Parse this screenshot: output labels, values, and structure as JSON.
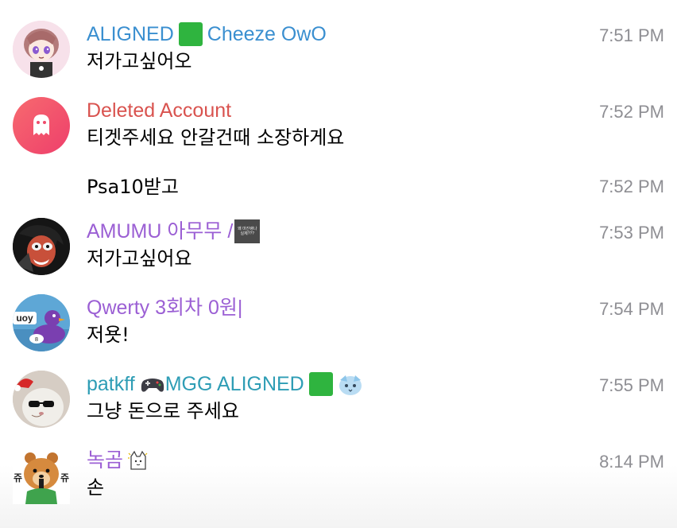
{
  "colors": {
    "name_blue": "#3a8fd0",
    "name_red": "#d9534f",
    "name_purple": "#9b5fd4",
    "name_teal": "#2e9db5",
    "timestamp": "#8e8e93",
    "ghost_avatar_bg": "#f0506a"
  },
  "messages": [
    {
      "sender": "ALIGNED",
      "sender_emoji": "green-square",
      "sender_suffix": "Cheeze OwO",
      "text": "저가고싶어오",
      "time": "7:51 PM",
      "avatar": "anime-character-avatar"
    },
    {
      "sender": "Deleted Account",
      "text": "티겟주세요 안갈건때 소장하게요",
      "time": "7:52 PM",
      "avatar": "ghost-icon"
    },
    {
      "text": "Psa10받고",
      "time": "7:52 PM"
    },
    {
      "sender": "AMUMU 아무무 /",
      "sender_badge_text": "왜 마진랭나 실제???",
      "text": "저가고싶어요",
      "time": "7:53 PM",
      "avatar": "manga-face-avatar"
    },
    {
      "sender": "Qwerty 3회차 0원|",
      "text": "저욧!",
      "time": "7:54 PM",
      "avatar": "purple-duck-avatar",
      "avatar_text": "uoy"
    },
    {
      "sender": "patkff",
      "sender_emoji": "gamepad-icon",
      "sender_middle": "MGG ALIGNED",
      "sender_emoji2": "green-square",
      "sender_emoji3": "cute-face-icon",
      "text": "그냥 돈으로 주세요",
      "time": "7:55 PM",
      "avatar": "cat-with-sunglasses-avatar"
    },
    {
      "sender": "녹곰",
      "sender_emoji": "cat-sticker-icon",
      "text": "손",
      "time": "8:14 PM",
      "avatar": "bear-avatar",
      "avatar_text_left": "쥬",
      "avatar_text_right": "쥬"
    }
  ]
}
